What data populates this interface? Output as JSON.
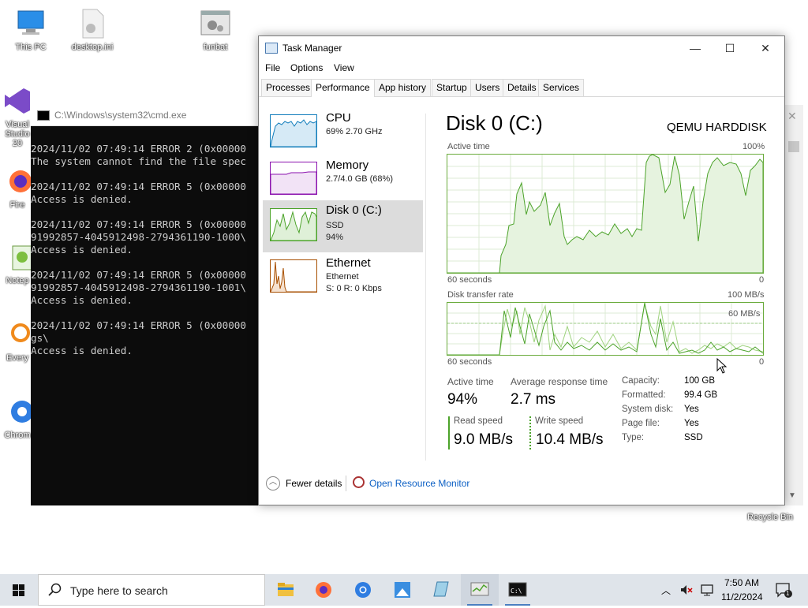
{
  "desktop": {
    "icons": [
      {
        "label": "This PC"
      },
      {
        "label": "desktop.ini"
      },
      {
        "label": "funbat"
      },
      {
        "label": "Visual Studio 20"
      },
      {
        "label": "Fire"
      },
      {
        "label": "Notep"
      },
      {
        "label": "Every"
      },
      {
        "label": "Chrom"
      },
      {
        "label": "Recycle Bin"
      }
    ]
  },
  "cmd": {
    "title": "C:\\Windows\\system32\\cmd.exe",
    "lines": [
      "",
      "2024/11/02 07:49:14 ERROR 2 (0x00000",
      "The system cannot find the file spec",
      "",
      "2024/11/02 07:49:14 ERROR 5 (0x00000",
      "Access is denied.",
      "",
      "2024/11/02 07:49:14 ERROR 5 (0x00000",
      "91992857-4045912498-2794361190-1000\\",
      "Access is denied.",
      "",
      "2024/11/02 07:49:14 ERROR 5 (0x00000",
      "91992857-4045912498-2794361190-1001\\",
      "Access is denied.",
      "",
      "2024/11/02 07:49:14 ERROR 5 (0x00000",
      "gs\\",
      "Access is denied."
    ]
  },
  "taskmanager": {
    "title": "Task Manager",
    "window_buttons": {
      "minimize": "—",
      "maximize": "☐",
      "close": "✕"
    },
    "menu": [
      "File",
      "Options",
      "View"
    ],
    "tabs": [
      "Processes",
      "Performance",
      "App history",
      "Startup",
      "Users",
      "Details",
      "Services"
    ],
    "active_tab": "Performance",
    "sidebar": [
      {
        "name": "CPU",
        "line1": "69%  2.70 GHz",
        "line2": ""
      },
      {
        "name": "Memory",
        "line1": "2.7/4.0 GB (68%)",
        "line2": ""
      },
      {
        "name": "Disk 0 (C:)",
        "line1": "SSD",
        "line2": "94%"
      },
      {
        "name": "Ethernet",
        "line1": "Ethernet",
        "line2": "S: 0  R: 0 Kbps"
      }
    ],
    "selected": "Disk 0 (C:)",
    "detail": {
      "title": "Disk 0 (C:)",
      "model": "QEMU HARDDISK",
      "active_graph": {
        "label": "Active time",
        "max": "100%",
        "xlabel": "60 seconds",
        "min": "0"
      },
      "transfer_graph": {
        "label": "Disk transfer rate",
        "max": "100 MB/s",
        "mid": "60 MB/s",
        "xlabel": "60 seconds",
        "min": "0"
      },
      "stats": {
        "active_time_label": "Active time",
        "active_time": "94%",
        "avg_response_label": "Average response time",
        "avg_response": "2.7 ms",
        "read_label": "Read speed",
        "read": "9.0 MB/s",
        "write_label": "Write speed",
        "write": "10.4 MB/s"
      },
      "props": [
        {
          "label": "Capacity:",
          "value": "100 GB"
        },
        {
          "label": "Formatted:",
          "value": "99.4 GB"
        },
        {
          "label": "System disk:",
          "value": "Yes"
        },
        {
          "label": "Page file:",
          "value": "Yes"
        },
        {
          "label": "Type:",
          "value": "SSD"
        }
      ]
    },
    "footer": {
      "fewer_details": "Fewer details",
      "resource_monitor": "Open Resource Monitor"
    },
    "colors": {
      "disk": "#4ca32a",
      "cpu": "#117dbb",
      "memory": "#8b12ae",
      "ethernet": "#a74f01"
    }
  },
  "taskbar": {
    "search_placeholder": "Type here to search",
    "time": "7:50 AM",
    "date": "11/2/2024",
    "notification_count": "1",
    "apps": [
      "file-explorer-icon",
      "firefox-icon",
      "chrome-icon",
      "paint-icon",
      "notepad-icon",
      "taskmanager-icon",
      "cmd-icon"
    ]
  }
}
